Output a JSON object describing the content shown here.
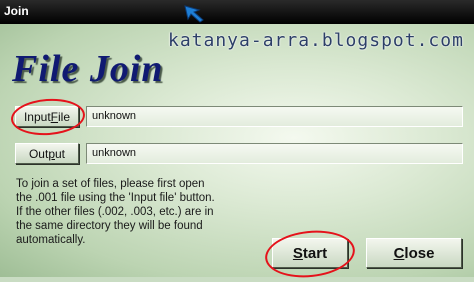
{
  "window": {
    "title": "Join"
  },
  "watermark": "katanya-arra.blogspot.com",
  "app_title": "File Join",
  "input": {
    "button_label_pre": "Input ",
    "button_label_accel": "F",
    "button_label_post": "ile",
    "value": "unknown"
  },
  "output": {
    "button_label_pre": "Out",
    "button_label_accel": "p",
    "button_label_post": "ut",
    "value": "unknown"
  },
  "help_lines": [
    "To join a set of files, please first open",
    "the .001 file using the 'Input file' button.",
    "If the other files (.002, .003, etc.) are in",
    "the same directory they will be found",
    "automatically."
  ],
  "actions": {
    "start_accel": "S",
    "start_rest": "tart",
    "close_accel": "C",
    "close_rest": "lose"
  },
  "colors": {
    "annotation": "#e5121b",
    "title_text": "#101a72",
    "cursor": "#1e7fd6"
  }
}
